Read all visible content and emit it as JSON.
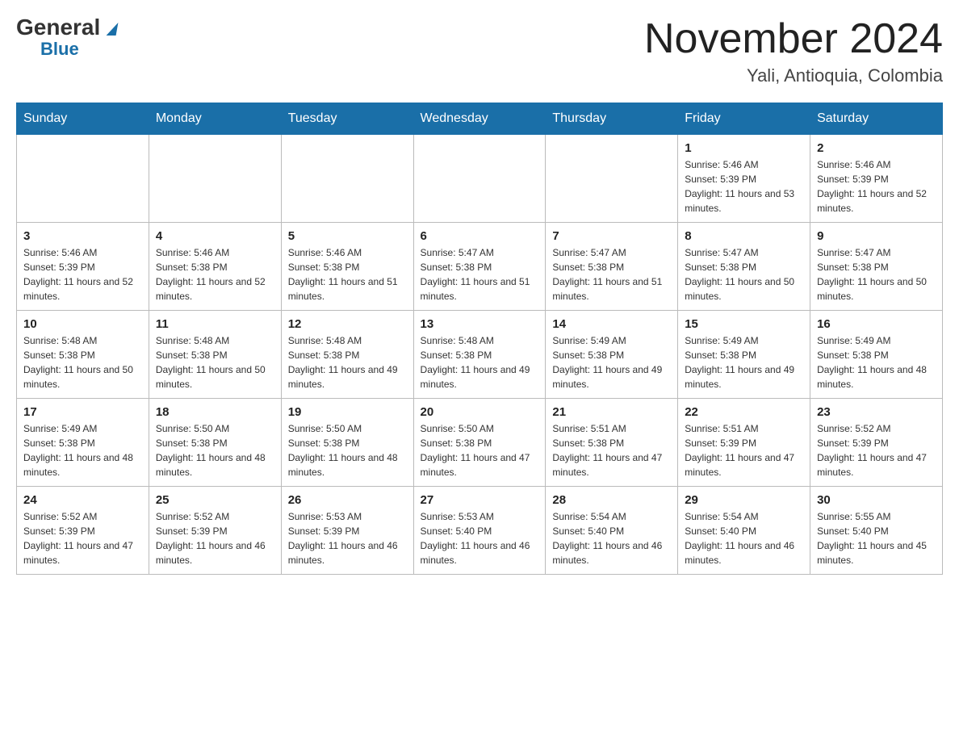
{
  "header": {
    "logo_general": "General",
    "logo_blue": "Blue",
    "title": "November 2024",
    "subtitle": "Yali, Antioquia, Colombia"
  },
  "days_of_week": [
    "Sunday",
    "Monday",
    "Tuesday",
    "Wednesday",
    "Thursday",
    "Friday",
    "Saturday"
  ],
  "weeks": [
    [
      {
        "day": "",
        "info": ""
      },
      {
        "day": "",
        "info": ""
      },
      {
        "day": "",
        "info": ""
      },
      {
        "day": "",
        "info": ""
      },
      {
        "day": "",
        "info": ""
      },
      {
        "day": "1",
        "info": "Sunrise: 5:46 AM\nSunset: 5:39 PM\nDaylight: 11 hours and 53 minutes."
      },
      {
        "day": "2",
        "info": "Sunrise: 5:46 AM\nSunset: 5:39 PM\nDaylight: 11 hours and 52 minutes."
      }
    ],
    [
      {
        "day": "3",
        "info": "Sunrise: 5:46 AM\nSunset: 5:39 PM\nDaylight: 11 hours and 52 minutes."
      },
      {
        "day": "4",
        "info": "Sunrise: 5:46 AM\nSunset: 5:38 PM\nDaylight: 11 hours and 52 minutes."
      },
      {
        "day": "5",
        "info": "Sunrise: 5:46 AM\nSunset: 5:38 PM\nDaylight: 11 hours and 51 minutes."
      },
      {
        "day": "6",
        "info": "Sunrise: 5:47 AM\nSunset: 5:38 PM\nDaylight: 11 hours and 51 minutes."
      },
      {
        "day": "7",
        "info": "Sunrise: 5:47 AM\nSunset: 5:38 PM\nDaylight: 11 hours and 51 minutes."
      },
      {
        "day": "8",
        "info": "Sunrise: 5:47 AM\nSunset: 5:38 PM\nDaylight: 11 hours and 50 minutes."
      },
      {
        "day": "9",
        "info": "Sunrise: 5:47 AM\nSunset: 5:38 PM\nDaylight: 11 hours and 50 minutes."
      }
    ],
    [
      {
        "day": "10",
        "info": "Sunrise: 5:48 AM\nSunset: 5:38 PM\nDaylight: 11 hours and 50 minutes."
      },
      {
        "day": "11",
        "info": "Sunrise: 5:48 AM\nSunset: 5:38 PM\nDaylight: 11 hours and 50 minutes."
      },
      {
        "day": "12",
        "info": "Sunrise: 5:48 AM\nSunset: 5:38 PM\nDaylight: 11 hours and 49 minutes."
      },
      {
        "day": "13",
        "info": "Sunrise: 5:48 AM\nSunset: 5:38 PM\nDaylight: 11 hours and 49 minutes."
      },
      {
        "day": "14",
        "info": "Sunrise: 5:49 AM\nSunset: 5:38 PM\nDaylight: 11 hours and 49 minutes."
      },
      {
        "day": "15",
        "info": "Sunrise: 5:49 AM\nSunset: 5:38 PM\nDaylight: 11 hours and 49 minutes."
      },
      {
        "day": "16",
        "info": "Sunrise: 5:49 AM\nSunset: 5:38 PM\nDaylight: 11 hours and 48 minutes."
      }
    ],
    [
      {
        "day": "17",
        "info": "Sunrise: 5:49 AM\nSunset: 5:38 PM\nDaylight: 11 hours and 48 minutes."
      },
      {
        "day": "18",
        "info": "Sunrise: 5:50 AM\nSunset: 5:38 PM\nDaylight: 11 hours and 48 minutes."
      },
      {
        "day": "19",
        "info": "Sunrise: 5:50 AM\nSunset: 5:38 PM\nDaylight: 11 hours and 48 minutes."
      },
      {
        "day": "20",
        "info": "Sunrise: 5:50 AM\nSunset: 5:38 PM\nDaylight: 11 hours and 47 minutes."
      },
      {
        "day": "21",
        "info": "Sunrise: 5:51 AM\nSunset: 5:38 PM\nDaylight: 11 hours and 47 minutes."
      },
      {
        "day": "22",
        "info": "Sunrise: 5:51 AM\nSunset: 5:39 PM\nDaylight: 11 hours and 47 minutes."
      },
      {
        "day": "23",
        "info": "Sunrise: 5:52 AM\nSunset: 5:39 PM\nDaylight: 11 hours and 47 minutes."
      }
    ],
    [
      {
        "day": "24",
        "info": "Sunrise: 5:52 AM\nSunset: 5:39 PM\nDaylight: 11 hours and 47 minutes."
      },
      {
        "day": "25",
        "info": "Sunrise: 5:52 AM\nSunset: 5:39 PM\nDaylight: 11 hours and 46 minutes."
      },
      {
        "day": "26",
        "info": "Sunrise: 5:53 AM\nSunset: 5:39 PM\nDaylight: 11 hours and 46 minutes."
      },
      {
        "day": "27",
        "info": "Sunrise: 5:53 AM\nSunset: 5:40 PM\nDaylight: 11 hours and 46 minutes."
      },
      {
        "day": "28",
        "info": "Sunrise: 5:54 AM\nSunset: 5:40 PM\nDaylight: 11 hours and 46 minutes."
      },
      {
        "day": "29",
        "info": "Sunrise: 5:54 AM\nSunset: 5:40 PM\nDaylight: 11 hours and 46 minutes."
      },
      {
        "day": "30",
        "info": "Sunrise: 5:55 AM\nSunset: 5:40 PM\nDaylight: 11 hours and 45 minutes."
      }
    ]
  ]
}
